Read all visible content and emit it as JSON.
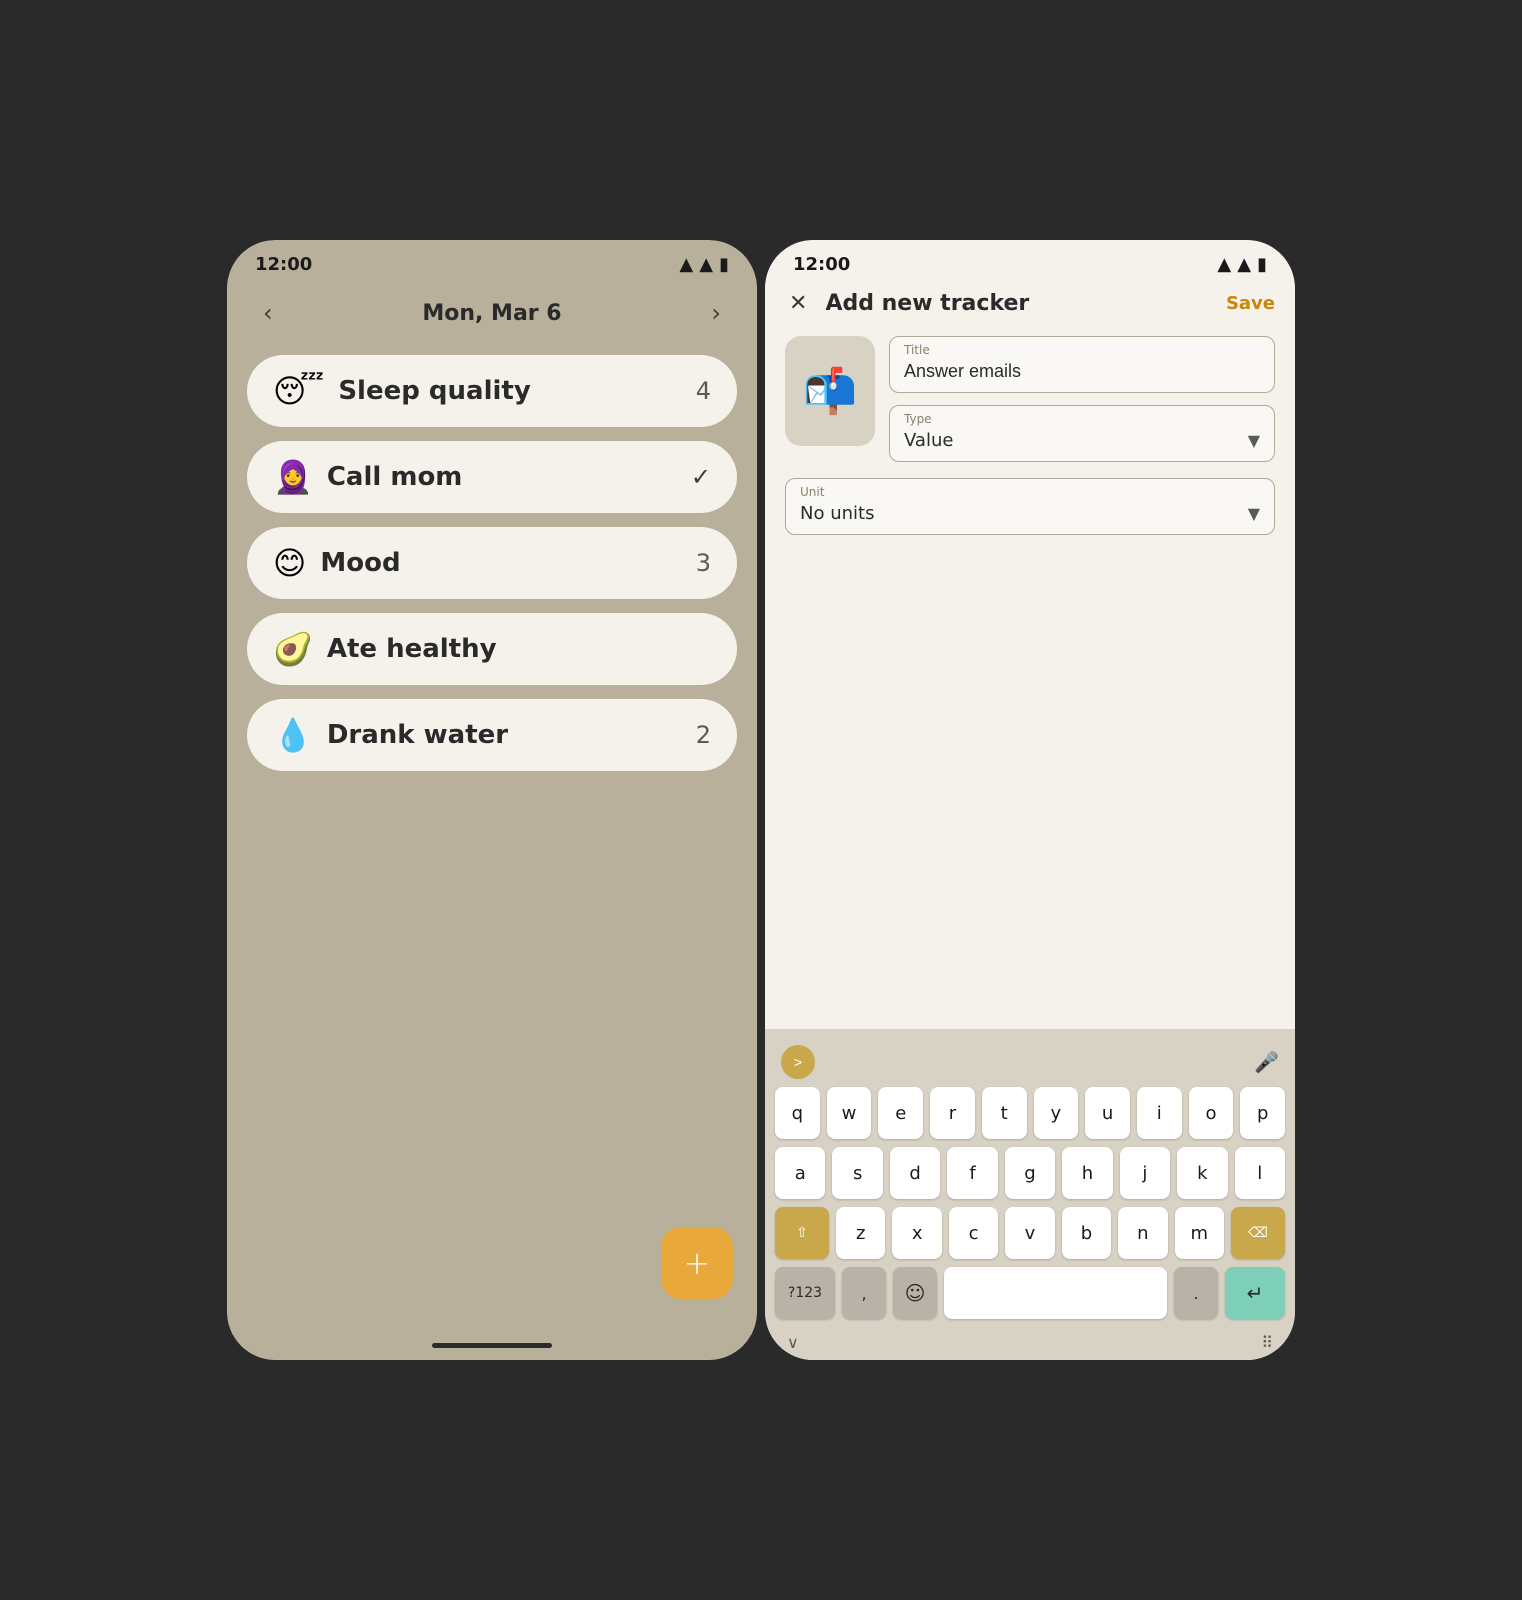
{
  "phone1": {
    "statusBar": {
      "time": "12:00"
    },
    "navigation": {
      "date": "Mon, Mar 6",
      "prevArrow": "‹",
      "nextArrow": "›"
    },
    "trackers": [
      {
        "emoji": "😴",
        "name": "Sleep quality",
        "value": "4",
        "type": "value"
      },
      {
        "emoji": "🧕",
        "name": "Call mom",
        "value": "✓",
        "type": "check"
      },
      {
        "emoji": "😊",
        "name": "Mood",
        "value": "3",
        "type": "value"
      },
      {
        "emoji": "🥑",
        "name": "Ate healthy",
        "value": "",
        "type": "boolean"
      },
      {
        "emoji": "💧",
        "name": "Drank water",
        "value": "2",
        "type": "value"
      }
    ],
    "fab": {
      "label": "+"
    }
  },
  "phone2": {
    "statusBar": {
      "time": "12:00"
    },
    "header": {
      "closeIcon": "✕",
      "title": "Add new tracker",
      "saveLabel": "Save"
    },
    "form": {
      "emojiIcon": "📬",
      "titleField": {
        "label": "Title",
        "value": "Answer emails"
      },
      "typeField": {
        "label": "Type",
        "value": "Value",
        "dropdownArrow": "▼"
      },
      "unitField": {
        "label": "Unit",
        "value": "No units",
        "dropdownArrow": "▼"
      }
    },
    "keyboard": {
      "expandBtn": ">",
      "micIcon": "🎤",
      "rows": [
        [
          "q",
          "w",
          "e",
          "r",
          "t",
          "y",
          "u",
          "i",
          "o",
          "p"
        ],
        [
          "a",
          "s",
          "d",
          "f",
          "g",
          "h",
          "j",
          "k",
          "l"
        ],
        [
          "z",
          "x",
          "c",
          "v",
          "b",
          "n",
          "m"
        ]
      ],
      "shiftLabel": "⇧",
      "deleteLabel": "⌫",
      "numLabel": "?123",
      "commaLabel": ",",
      "emojiLabel": "☺",
      "spaceLabel": "",
      "dotLabel": ".",
      "enterLabel": "↵",
      "chevronDown": "∨",
      "dotsIcon": "⠿"
    }
  }
}
